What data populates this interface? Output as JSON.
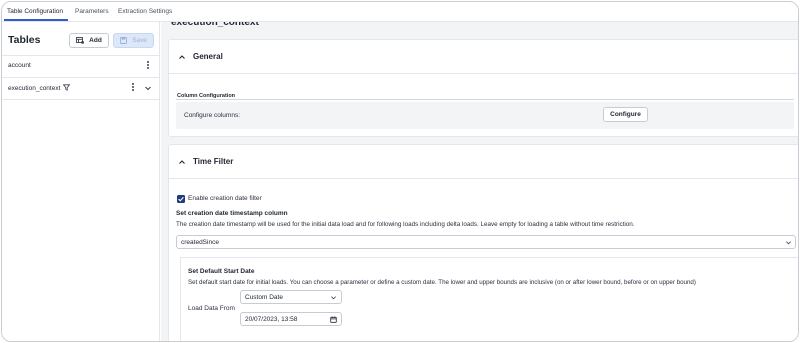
{
  "tabs": [
    {
      "label": "Table Configuration",
      "active": true
    },
    {
      "label": "Parameters",
      "active": false
    },
    {
      "label": "Extraction Settings",
      "active": false
    }
  ],
  "sidebar": {
    "title": "Tables",
    "add_label": "Add",
    "save_label": "Save",
    "items": [
      {
        "label": "account"
      },
      {
        "label": "execution_context"
      }
    ]
  },
  "main": {
    "cut_title": "execution_context",
    "general": {
      "title": "General",
      "column_config_label": "Column Configuration",
      "configure_columns_label": "Configure columns:",
      "configure_button": "Configure"
    },
    "time_filter": {
      "title": "Time Filter",
      "enable_label": "Enable creation date filter",
      "enable_checked": true,
      "timestamp_heading": "Set creation date timestamp column",
      "timestamp_desc": "The creation date timestamp will be used for the initial data load and for following loads including delta loads. Leave empty for loading a table without time restriction.",
      "timestamp_value": "createdSince",
      "start_heading": "Set Default Start Date",
      "start_desc": "Set default start date for initial loads. You can choose a parameter or define a custom date. The lower and upper bounds are inclusive (on or after lower bound, before or on upper bound)",
      "date_type_value": "Custom Date",
      "load_from_label": "Load Data From",
      "load_from_value": "20/07/2023, 13:58"
    }
  },
  "colors": {
    "accent": "#2f5bd3",
    "checkbox": "#1f3d7a",
    "save_disabled_bg": "#dce7f8"
  }
}
